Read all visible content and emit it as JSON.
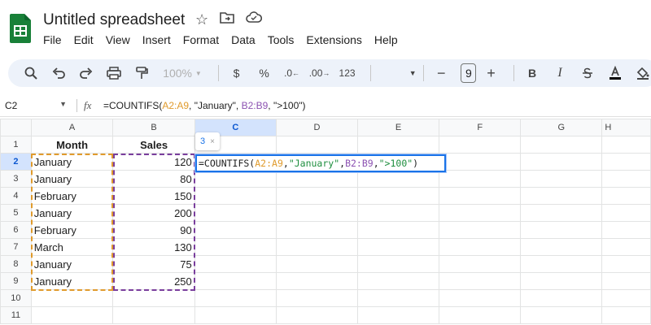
{
  "app": {
    "title": "Untitled spreadsheet"
  },
  "menu": [
    "File",
    "Edit",
    "View",
    "Insert",
    "Format",
    "Data",
    "Tools",
    "Extensions",
    "Help"
  ],
  "toolbar": {
    "zoom": "100%",
    "currency": "$",
    "percent": "%",
    "decrease_decimal": ".0",
    "increase_decimal": ".00",
    "number_format": "123",
    "font_size": "9",
    "bold": "B",
    "italic": "I"
  },
  "formula_bar": {
    "name_box": "C2",
    "fx": "fx",
    "formula_prefix": "=COUNTIFS(",
    "arg1": "A2:A9",
    "arg2": ", \"January\", ",
    "arg3": "B2:B9",
    "arg4": ", \">100\")"
  },
  "editor": {
    "prefix": "=COUNTIFS(",
    "arg1": "A2:A9",
    "sep1": ", ",
    "arg2": "\"January\"",
    "sep2": ", ",
    "arg3": "B2:B9",
    "sep3": ", ",
    "arg4": "\">100\"",
    "suffix": ")"
  },
  "tooltip": {
    "value": "3",
    "close": "×"
  },
  "columns": [
    "A",
    "B",
    "C",
    "D",
    "E",
    "F",
    "G",
    "H"
  ],
  "rows": [
    "1",
    "2",
    "3",
    "4",
    "5",
    "6",
    "7",
    "8",
    "9",
    "10",
    "11"
  ],
  "headers": {
    "a": "Month",
    "b": "Sales"
  },
  "data": [
    {
      "month": "January",
      "sales": "120"
    },
    {
      "month": "January",
      "sales": "80"
    },
    {
      "month": "February",
      "sales": "150"
    },
    {
      "month": "January",
      "sales": "200"
    },
    {
      "month": "February",
      "sales": "90"
    },
    {
      "month": "March",
      "sales": "130"
    },
    {
      "month": "January",
      "sales": "75"
    },
    {
      "month": "January",
      "sales": "250"
    }
  ],
  "colors": {
    "accent": "#1a73e8",
    "range_a": "#e09b2d",
    "range_b": "#7a3e9d",
    "string": "#1e8e3e",
    "sheets_green": "#188038"
  }
}
